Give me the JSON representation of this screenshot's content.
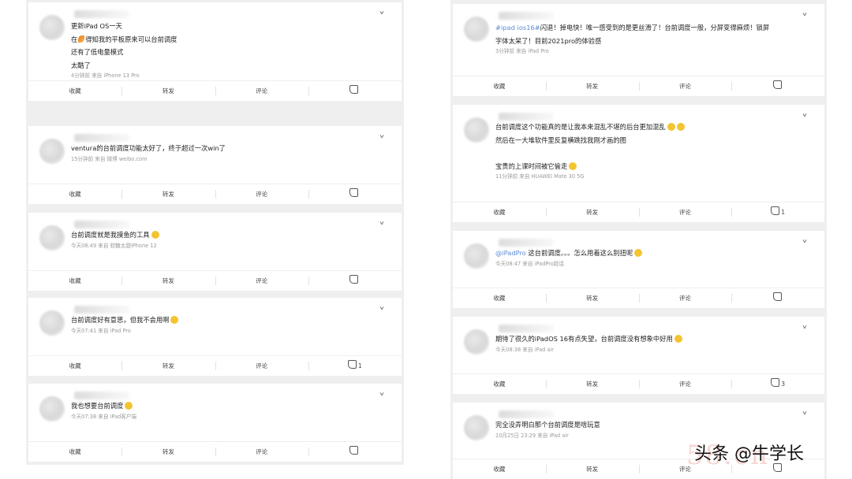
{
  "left_column": [
    {
      "lines": [
        "更新iPad OS一天",
        "在[leaf]得知我的平板原来可以台前调度",
        "还有了低电量模式",
        "太酷了"
      ],
      "meta": "4分钟前  来自 iPhone 13 Pro",
      "actions": {
        "fav": "收藏",
        "repost": "转发",
        "comment": "评论",
        "like_count": ""
      }
    },
    {
      "lines": [
        "ventura的台前调度功能太好了，终于超过一次win了"
      ],
      "meta": "15分钟前  来自 微博 weibo.com",
      "actions": {
        "fav": "收藏",
        "repost": "转发",
        "comment": "评论",
        "like_count": ""
      }
    },
    {
      "lines": [
        "台前调度就是我摸鱼的工具[emo]"
      ],
      "meta": "今天08:49  来自 软糖太甜iPhone 12",
      "actions": {
        "fav": "收藏",
        "repost": "转发",
        "comment": "评论",
        "like_count": ""
      }
    },
    {
      "lines": [
        "台前调度好有意思，但我不会用啊[emo]"
      ],
      "meta": "今天07:41  来自 iPad Pro",
      "actions": {
        "fav": "收藏",
        "repost": "转发",
        "comment": "评论",
        "like_count": "1"
      }
    },
    {
      "lines": [
        "我也想要台前调度[emo]"
      ],
      "meta": "今天07:38  来自 iPad客户端",
      "actions": {
        "fav": "收藏",
        "repost": "转发",
        "comment": "评论",
        "like_count": ""
      }
    }
  ],
  "right_column": [
    {
      "lines": [
        "#ipad ios16#闪退！掉电快！唯一感受到的是更丝滑了！台前调度一般，分屏变得麻烦！锁屏",
        "字体太呆了！目前2021pro的体验感"
      ],
      "meta": "3分钟前  来自 iPad Pro",
      "actions": {
        "fav": "收藏",
        "repost": "转发",
        "comment": "评论",
        "like_count": ""
      }
    },
    {
      "lines": [
        "台前调度这个功能真的是让我本来混乱不堪的后台更加混乱[emo][emo]",
        "然后在一大堆软件里反复横跳找我刚才画的图",
        "",
        "宝贵的上课时间被它偷走[emo]"
      ],
      "meta": "11分钟前  来自 HUAWEI Mate 30 5G",
      "actions": {
        "fav": "收藏",
        "repost": "转发",
        "comment": "评论",
        "like_count": "1"
      }
    },
    {
      "lines": [
        "@iPadPro 这台前调度。。。怎么用着这么别扭呢[emo]"
      ],
      "meta": "今天08:47  来自 iPadPro超话",
      "actions": {
        "fav": "收藏",
        "repost": "转发",
        "comment": "评论",
        "like_count": ""
      }
    },
    {
      "lines": [
        "期待了很久的iPadOS 16有点失望，台前调度没有想象中好用[emo]"
      ],
      "meta": "今天08:38  来自 iPad air",
      "actions": {
        "fav": "收藏",
        "repost": "转发",
        "comment": "评论",
        "like_count": "3"
      }
    },
    {
      "lines": [
        "完全没弄明白那个台前调度是啥玩意"
      ],
      "meta": "10月25日 23:29  来自 iPad air",
      "actions": {
        "fav": "收藏",
        "repost": "转发",
        "comment": "评论",
        "like_count": ""
      }
    }
  ],
  "watermark": {
    "text": "头条 @牛学长",
    "ghost": "58.cn"
  }
}
